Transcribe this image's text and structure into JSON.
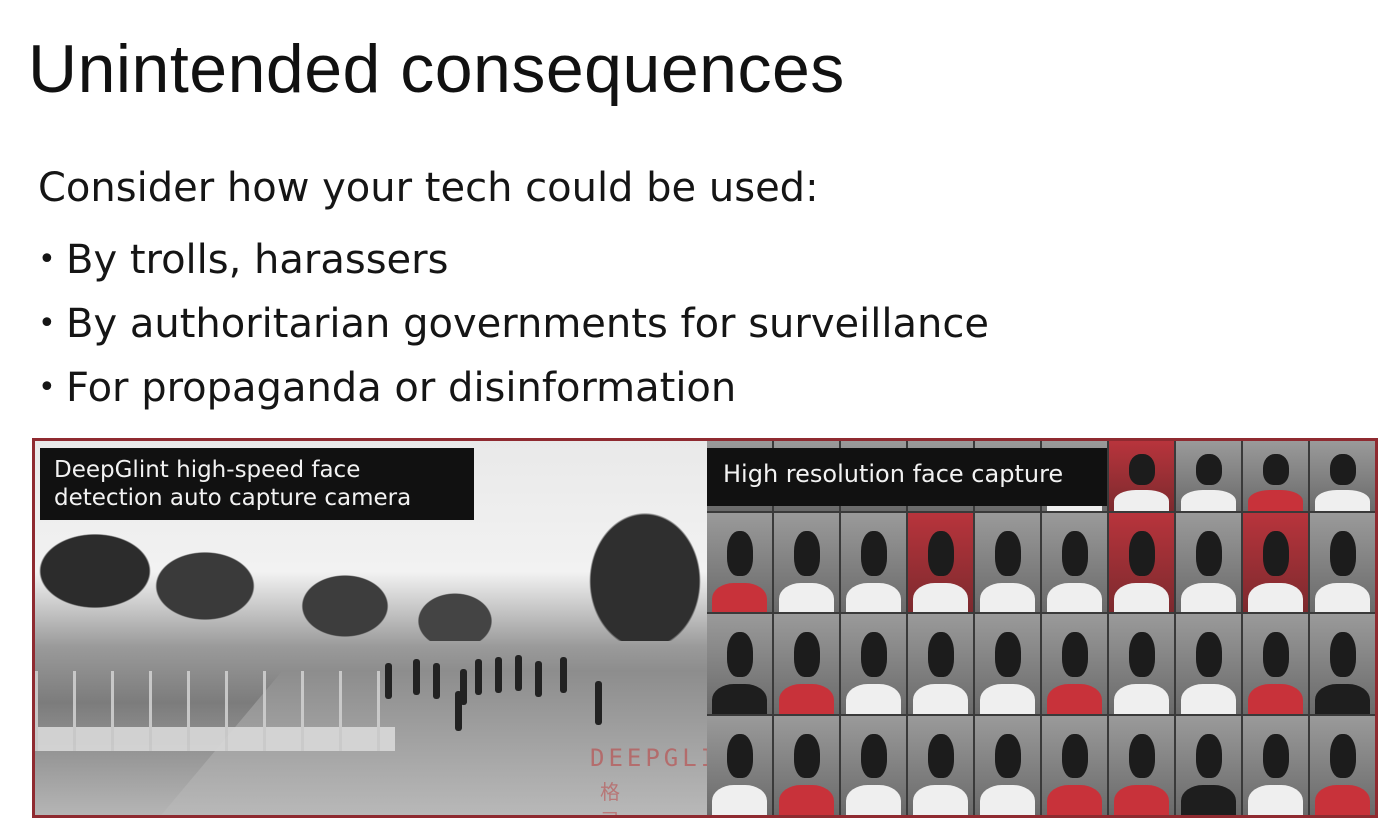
{
  "slide": {
    "title": "Unintended consequences",
    "intro": "Consider how your tech could be used:",
    "bullets": [
      "By trolls, harassers",
      "By authoritarian governments for surveillance",
      "For propaganda or disinformation"
    ],
    "bullet_glyph": "•"
  },
  "image": {
    "caption_left": "DeepGlint high-speed face detection auto capture camera",
    "caption_right": "High resolution face capture",
    "watermark": "DEEPGLINT",
    "watermark_sub": "格 灵",
    "frame_color": "#8f2a30"
  }
}
